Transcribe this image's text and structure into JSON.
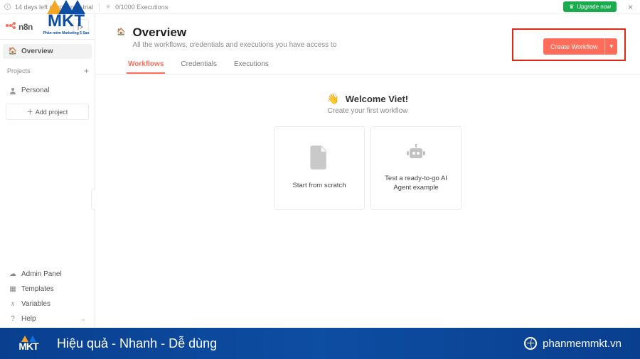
{
  "trial": {
    "days_text": "14 days left in your n8n trial",
    "executions": "0/1000 Executions",
    "upgrade_label": "Upgrade now",
    "close_label": "×"
  },
  "brand": {
    "name": "n8n"
  },
  "sidebar": {
    "overview_label": "Overview",
    "projects_section": "Projects",
    "projects_add_icon": "+",
    "personal_label": "Personal",
    "add_project_label": "Add project",
    "bottom": {
      "admin_panel": "Admin Panel",
      "templates": "Templates",
      "variables": "Variables",
      "help": "Help"
    }
  },
  "page": {
    "title": "Overview",
    "subtitle": "All the workflows, credentials and executions you have access to"
  },
  "actions": {
    "create_workflow": "Create Workflow",
    "dropdown_glyph": "▾"
  },
  "tabs": {
    "workflows": "Workflows",
    "credentials": "Credentials",
    "executions": "Executions"
  },
  "welcome": {
    "emoji": "👋",
    "title": "Welcome Viet!",
    "subtitle": "Create your first workflow"
  },
  "cards": {
    "scratch": "Start from scratch",
    "agent": "Test a ready-to-go AI Agent example"
  },
  "banner": {
    "tagline": "Hiệu quả - Nhanh - Dễ dùng",
    "url": "phanmemmkt.vn",
    "logo_text": "MKT"
  },
  "watermark": {
    "text": "MKT",
    "sub": "Phần mềm Marketing 5 Sao"
  }
}
